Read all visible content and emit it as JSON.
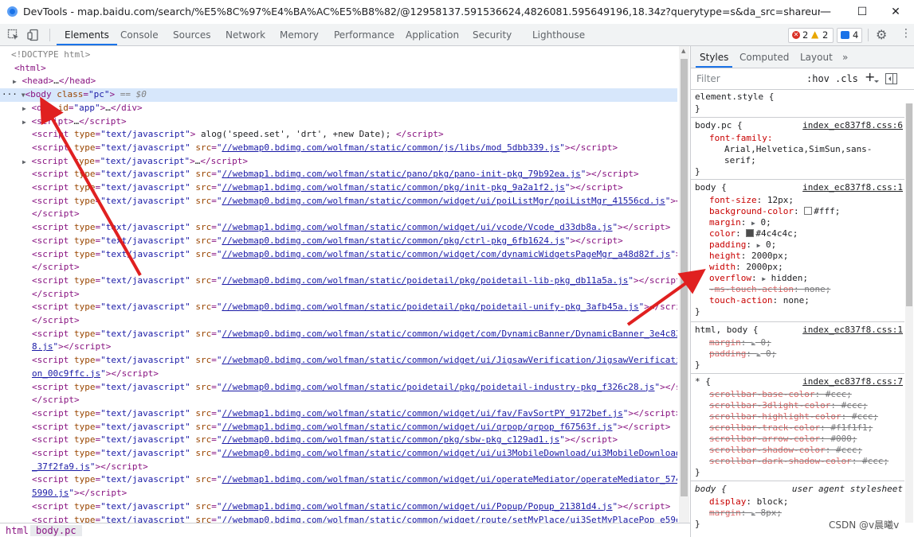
{
  "window": {
    "title": "DevTools - map.baidu.com/search/%E5%8C%97%E4%BA%AC%E5%B8%82/@12958137.591536624,4826081.595649196,18.34z?querytype=s&da_src=shareurl&wd=%E...",
    "minimize": "—",
    "maximize": "☐",
    "close": "✕"
  },
  "tabs": [
    "Elements",
    "Console",
    "Sources",
    "Network",
    "Memory",
    "Performance",
    "Application",
    "Security",
    "Lighthouse"
  ],
  "badges": {
    "errors": "2",
    "warnings": "2",
    "messages": "4"
  },
  "tree": [
    "&lt;!DOCTYPE html&gt;",
    "&lt;html&gt;",
    "&lt;head&gt;…&lt;/head&gt;",
    "&lt;body class=\"pc\"&gt; == $0",
    "&lt;div id=\"app\"&gt;…&lt;/div&gt;",
    "&lt;script&gt;…&lt;/script&gt;"
  ],
  "tree_lines": [
    {
      "type": "doctype",
      "text": "<!DOCTYPE html>"
    },
    {
      "type": "plain",
      "indent": 0,
      "html": "<html>"
    },
    {
      "type": "collapsed",
      "indent": 1,
      "tag": "head"
    },
    {
      "type": "body",
      "indent": 1
    },
    {
      "type": "collapsed",
      "indent": 2,
      "tag": "div",
      "attr": "id",
      "val": "app"
    },
    {
      "type": "collapsed",
      "indent": 2,
      "tag": "script"
    },
    {
      "type": "inline",
      "text": "alog('speed.set', 'drt', +new Date);"
    },
    {
      "type": "src",
      "url": "//webmap0.bdimg.com/wolfman/static/common/js/libs/mod_5dbb339.js"
    },
    {
      "type": "collapsed",
      "indent": 2,
      "tag": "script",
      "attr": "type",
      "val": "text/javascript"
    },
    {
      "type": "src",
      "url": "//webmap1.bdimg.com/wolfman/static/pano/pkg/pano-init-pkg_79b92ea.js"
    },
    {
      "type": "src",
      "url": "//webmap1.bdimg.com/wolfman/static/common/pkg/init-pkg_9a2a1f2.js"
    },
    {
      "type": "src",
      "url": "//webmap0.bdimg.com/wolfman/static/common/widget/ui/poiListMgr/poiListMgr_41556cd.js"
    },
    {
      "type": "close"
    },
    {
      "type": "src",
      "url": "//webmap1.bdimg.com/wolfman/static/common/widget/ui/vcode/Vcode_d33db8a.js"
    },
    {
      "type": "src",
      "url": "//webmap0.bdimg.com/wolfman/static/common/pkg/ctrl-pkg_6fb1624.js"
    },
    {
      "type": "src",
      "url": "//webmap0.bdimg.com/wolfman/static/common/widget/com/dynamicWidgetsPageMgr_a48d82f.js"
    },
    {
      "type": "close"
    },
    {
      "type": "src",
      "url": "//webmap0.bdimg.com/wolfman/static/poidetail/pkg/poidetail-lib-pkg_db11a5a.js"
    },
    {
      "type": "close"
    },
    {
      "type": "src",
      "url": "//webmap0.bdimg.com/wolfman/static/poidetail/pkg/poidetail-unify-pkg_3afb45a.js"
    },
    {
      "type": "close"
    },
    {
      "type": "src",
      "url": "//webmap0.bdimg.com/wolfman/static/common/widget/com/DynamicBanner/DynamicBanner_3e4c83"
    },
    {
      "type": "cont",
      "url": "8.js"
    },
    {
      "type": "src",
      "url": "//webmap0.bdimg.com/wolfman/static/common/widget/ui/JigsawVerification/JigsawVerificati"
    },
    {
      "type": "cont",
      "url": "on_00c9ffc.js"
    },
    {
      "type": "src",
      "url": "//webmap0.bdimg.com/wolfman/static/poidetail/pkg/poidetail-industry-pkg_f326c28.js"
    },
    {
      "type": "close"
    },
    {
      "type": "src",
      "url": "//webmap1.bdimg.com/wolfman/static/common/widget/ui/fav/FavSortPY_9172bef.js"
    },
    {
      "type": "src",
      "url": "//webmap1.bdimg.com/wolfman/static/common/widget/ui/qrpop/qrpop_f67563f.js"
    },
    {
      "type": "src",
      "url": "//webmap0.bdimg.com/wolfman/static/common/pkg/sbw-pkg_c129ad1.js"
    },
    {
      "type": "src",
      "url": "//webmap0.bdimg.com/wolfman/static/common/widget/ui/ui3MobileDownload/ui3MobileDownload"
    },
    {
      "type": "cont",
      "url": "_37f2fa9.js"
    },
    {
      "type": "src",
      "url": "//webmap1.bdimg.com/wolfman/static/common/widget/ui/operateMediator/operateMediator_574"
    },
    {
      "type": "cont",
      "url": "5990.js"
    },
    {
      "type": "src",
      "url": "//webmap1.bdimg.com/wolfman/static/common/widget/ui/Popup/Popup_21381d4.js"
    },
    {
      "type": "src",
      "url": "//webmap0.bdimg.com/wolfman/static/common/widget/route/setMyPlace/ui3SetMyPlacePop_e59e"
    }
  ],
  "strings": {
    "script_type": "text/javascript",
    "body_suffix": " == $0"
  },
  "breadcrumbs": [
    "html",
    "body.pc"
  ],
  "side_tabs": [
    "Styles",
    "Computed",
    "Layout",
    "»"
  ],
  "filter": {
    "placeholder": "Filter",
    "hov": ":hov",
    "cls": ".cls",
    "plus": "+"
  },
  "rules": {
    "element_style": {
      "selector": "element.style {",
      "close": "}"
    },
    "body_pc": {
      "selector": "body.pc {",
      "source": "index_ec837f8.css:6",
      "prop": "font-family:",
      "value1": "Arial,Helvetica,SimSun,sans-",
      "value2": "serif;"
    },
    "body": {
      "selector": "body {",
      "source": "index_ec837f8.css:1",
      "decls": [
        {
          "n": "font-size",
          "v": "12px;"
        },
        {
          "n": "background-color",
          "v": "#fff;",
          "swatch": "#ffffff"
        },
        {
          "n": "margin",
          "v": "0;",
          "tri": true
        },
        {
          "n": "color",
          "v": "#4c4c4c;",
          "swatch": "#4c4c4c"
        },
        {
          "n": "padding",
          "v": "0;",
          "tri": true
        },
        {
          "n": "height",
          "v": "2000px;"
        },
        {
          "n": "width",
          "v": "2000px;"
        },
        {
          "n": "overflow",
          "v": "hidden;",
          "tri": true
        },
        {
          "n": "-ms-touch-action",
          "v": "none;",
          "strike": true
        },
        {
          "n": "touch-action",
          "v": "none;"
        }
      ]
    },
    "html_body": {
      "selector": "html, body {",
      "source": "index_ec837f8.css:1",
      "decls": [
        {
          "n": "margin",
          "v": "0;",
          "strike": true,
          "tri": true
        },
        {
          "n": "padding",
          "v": "0;",
          "strike": true,
          "tri": true
        }
      ]
    },
    "star": {
      "selector": "* {",
      "source": "index_ec837f8.css:7",
      "decls": [
        {
          "n": "scrollbar-base-color",
          "v": "#ccc;"
        },
        {
          "n": "scrollbar-3dlight-color",
          "v": "#ccc;"
        },
        {
          "n": "scrollbar-highlight-color",
          "v": "#ccc;"
        },
        {
          "n": "scrollbar-track-color",
          "v": "#f1f1f1;"
        },
        {
          "n": "scrollbar-arrow-color",
          "v": "#000;"
        },
        {
          "n": "scrollbar-shadow-color",
          "v": "#ccc;"
        },
        {
          "n": "scrollbar-dark-shadow-color",
          "v": "#ccc;"
        }
      ]
    },
    "ua": {
      "selector": "body {",
      "source": "user agent stylesheet",
      "decls": [
        {
          "n": "display",
          "v": "block;"
        },
        {
          "n": "margin",
          "v": "8px;",
          "strike": true,
          "tri": true
        }
      ]
    }
  },
  "watermark": "CSDN @v晨曦v",
  "colors": {
    "accent": "#1a73e8",
    "arrow": "#e02020",
    "tag": "#881280",
    "attr_name": "#994500",
    "attr_value": "#1a1aa6"
  }
}
